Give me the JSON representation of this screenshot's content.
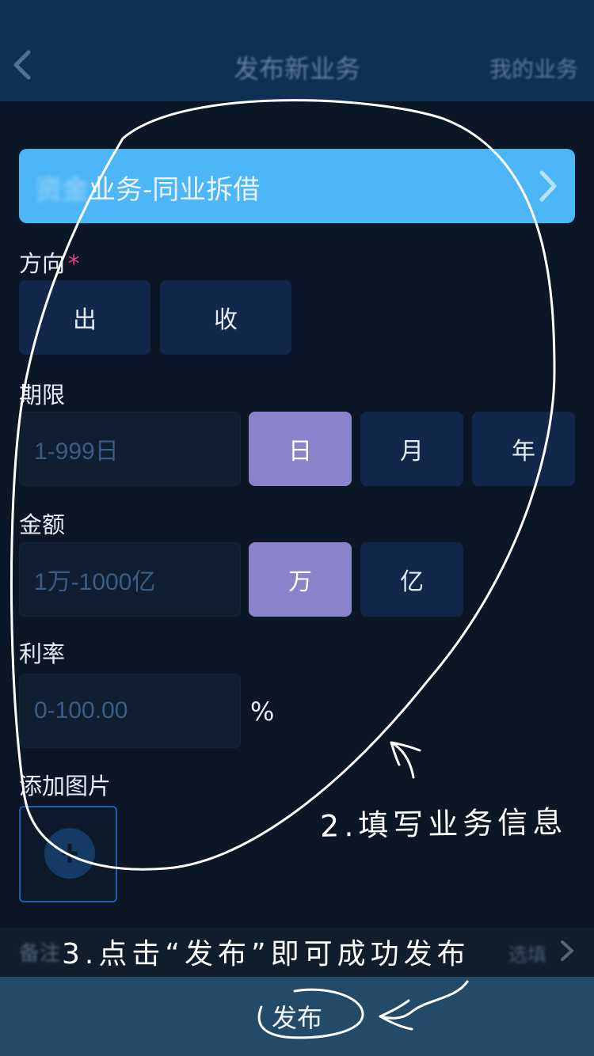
{
  "header": {
    "title": "发布新业务",
    "right_link": "我的业务"
  },
  "category": {
    "prefix": "资金",
    "text": "业务-同业拆借"
  },
  "direction": {
    "label": "方向",
    "required_mark": "*",
    "options": [
      "出",
      "收"
    ]
  },
  "term": {
    "label": "期限",
    "placeholder": "1-999日",
    "units": [
      "日",
      "月",
      "年"
    ],
    "selected": "日"
  },
  "amount": {
    "label": "金额",
    "placeholder": "1万-1000亿",
    "units": [
      "万",
      "亿"
    ],
    "selected": "万"
  },
  "rate": {
    "label": "利率",
    "placeholder": "0-100.00",
    "unit": "%"
  },
  "images": {
    "label": "添加图片"
  },
  "remarks": {
    "label": "备注",
    "hint": "选填"
  },
  "footer": {
    "publish_label": "发布"
  },
  "annotations": {
    "step2": "2.填写业务信息",
    "step3": "3.点击“发布”即可成功发布"
  },
  "colors": {
    "background": "#0b1726",
    "header": "#0f2f55",
    "category_bar": "#4db6f6",
    "selected_option": "#8a83cc",
    "option": "#11284a",
    "publish_bar": "#234a68",
    "required": "#e83e7a"
  }
}
